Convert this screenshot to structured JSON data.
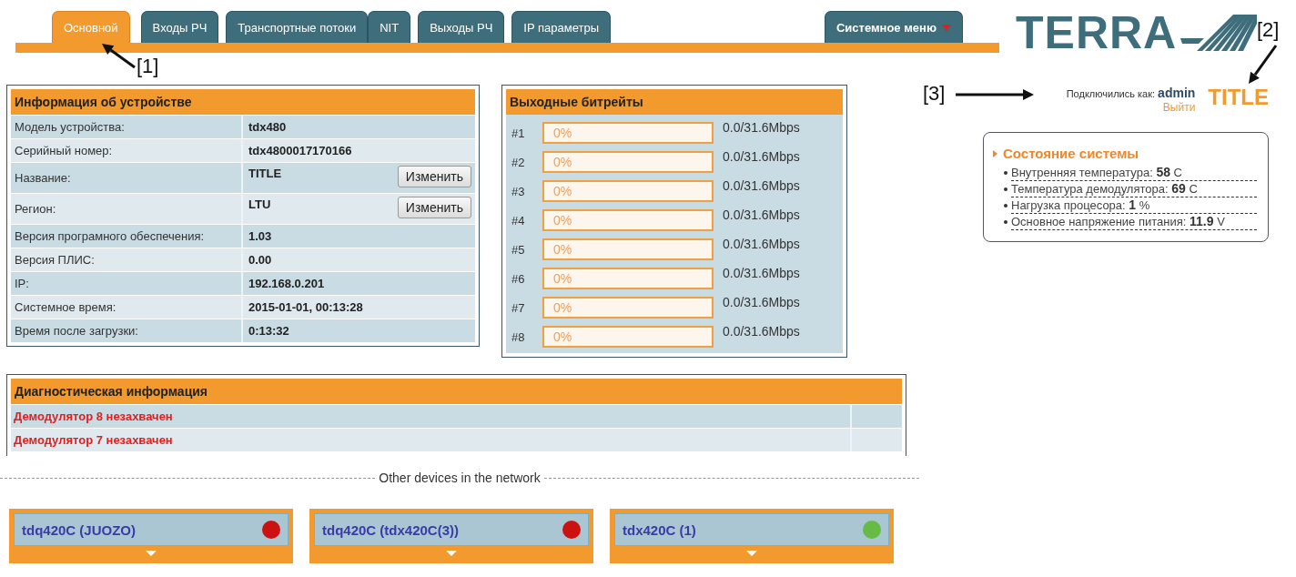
{
  "tabs": [
    {
      "label": "Основной",
      "selected": true
    },
    {
      "label": "Входы РЧ",
      "selected": false
    },
    {
      "label": "Транспортные потоки",
      "selected": false
    },
    {
      "label": "NIT",
      "selected": false
    },
    {
      "label": "Выходы РЧ",
      "selected": false
    },
    {
      "label": "IP параметры",
      "selected": false
    }
  ],
  "system_menu": {
    "label": "Системное меню"
  },
  "logo": {
    "text": "TERRA"
  },
  "device_info": {
    "title": "Информация об устройстве",
    "rows": [
      {
        "label": "Модель устройства:",
        "value": "tdx480"
      },
      {
        "label": "Серийный номер:",
        "value": "tdx4800017170166"
      },
      {
        "label": "Название:",
        "value": "TITLE",
        "button": "Изменить"
      },
      {
        "label": "Регион:",
        "value": "LTU",
        "button": "Изменить"
      },
      {
        "label": "Версия програмного обеспечения:",
        "value": "1.03"
      },
      {
        "label": "Версия ПЛИС:",
        "value": "0.00"
      },
      {
        "label": "IP:",
        "value": "192.168.0.201"
      },
      {
        "label": "Системное время:",
        "value": "2015-01-01, 00:13:28"
      },
      {
        "label": "Время после загрузки:",
        "value": "0:13:32"
      }
    ]
  },
  "bitrates": {
    "title": "Выходные битрейты",
    "rows": [
      {
        "label": "#1",
        "level": 0,
        "percent": "0%",
        "rate": "0.0/31.6Mbps"
      },
      {
        "label": "#2",
        "level": 0,
        "percent": "0%",
        "rate": "0.0/31.6Mbps"
      },
      {
        "label": "#3",
        "level": 0,
        "percent": "0%",
        "rate": "0.0/31.6Mbps"
      },
      {
        "label": "#4",
        "level": 0,
        "percent": "0%",
        "rate": "0.0/31.6Mbps"
      },
      {
        "label": "#5",
        "level": 0,
        "percent": "0%",
        "rate": "0.0/31.6Mbps"
      },
      {
        "label": "#6",
        "level": 0,
        "percent": "0%",
        "rate": "0.0/31.6Mbps"
      },
      {
        "label": "#7",
        "level": 0,
        "percent": "0%",
        "rate": "0.0/31.6Mbps"
      },
      {
        "label": "#8",
        "level": 0,
        "percent": "0%",
        "rate": "0.0/31.6Mbps"
      }
    ]
  },
  "session": {
    "prefix": "Подключились как:",
    "user": "admin",
    "logout": "Выйти",
    "device_name": "TITLE"
  },
  "system_status": {
    "title": "Состояние системы",
    "items": [
      {
        "label": "Внутренняя температура:",
        "value": "58",
        "unit": "C"
      },
      {
        "label": "Температура демодулятора:",
        "value": "69",
        "unit": "C"
      },
      {
        "label": "Нагрузка процесора:",
        "value": "1",
        "unit": "%"
      },
      {
        "label": "Основное напряжение питания:",
        "value": "11.9",
        "unit": "V"
      }
    ]
  },
  "diagnostics": {
    "title": "Диагностическая информация",
    "rows": [
      "Демодулятор 8 незахвачен",
      "Демодулятор 7 незахвачен"
    ]
  },
  "network": {
    "title": "Other devices in the network",
    "devices": [
      {
        "name": "tdq420C (JUOZO)",
        "color": "#cc1111"
      },
      {
        "name": "tdq420C (tdx420C(3))",
        "color": "#cc1111"
      },
      {
        "name": "tdx420C (1)",
        "color": "#66bb44"
      }
    ]
  },
  "callouts": [
    {
      "label": "[1]"
    },
    {
      "label": "[2]"
    },
    {
      "label": "[3]"
    }
  ]
}
